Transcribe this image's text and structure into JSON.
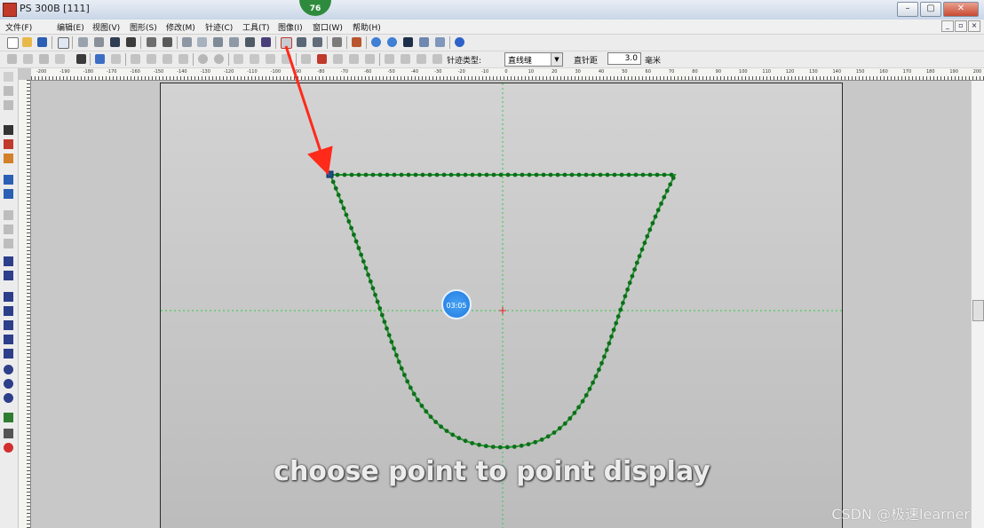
{
  "window": {
    "title": "PS 300B  [111]",
    "top_badge": "76",
    "buttons": [
      "–",
      "▢",
      "✕"
    ]
  },
  "menu": {
    "items": [
      "文件(F)",
      "编辑(E)",
      "视图(V)",
      "图形(S)",
      "修改(M)",
      "针迹(C)",
      "工具(T)",
      "图像(I)",
      "窗口(W)",
      "帮助(H)"
    ],
    "mdi_buttons": [
      "_",
      "▫",
      "×"
    ]
  },
  "toolbar2": {
    "stitch_type_label": "针迹类型:",
    "stitch_type_value": "直线缝",
    "stitch_length_label": "直针距",
    "stitch_length_value": "3.0",
    "stitch_length_unit": "毫米"
  },
  "ruler": {
    "ticks": [
      "-200",
      "-190",
      "-180",
      "-170",
      "-160",
      "-150",
      "-140",
      "-130",
      "-120",
      "-110",
      "-100",
      "-90",
      "-80",
      "-70",
      "-60",
      "-50",
      "-40",
      "-30",
      "-20",
      "-10",
      "0",
      "10",
      "20",
      "30",
      "40",
      "50",
      "60",
      "70",
      "80",
      "90",
      "100",
      "110",
      "120",
      "130",
      "140",
      "150",
      "160",
      "170",
      "180",
      "190",
      "200"
    ]
  },
  "video_overlay": {
    "timer": "03:05",
    "subtitle": "choose point to point display",
    "watermark": "CSDN @极速learner"
  },
  "colors": {
    "stitch_line": "#1f9a2e",
    "stitch_point": "#0f6e1b",
    "guide_line": "#2ecc40",
    "arrow": "#ff2a1a"
  }
}
